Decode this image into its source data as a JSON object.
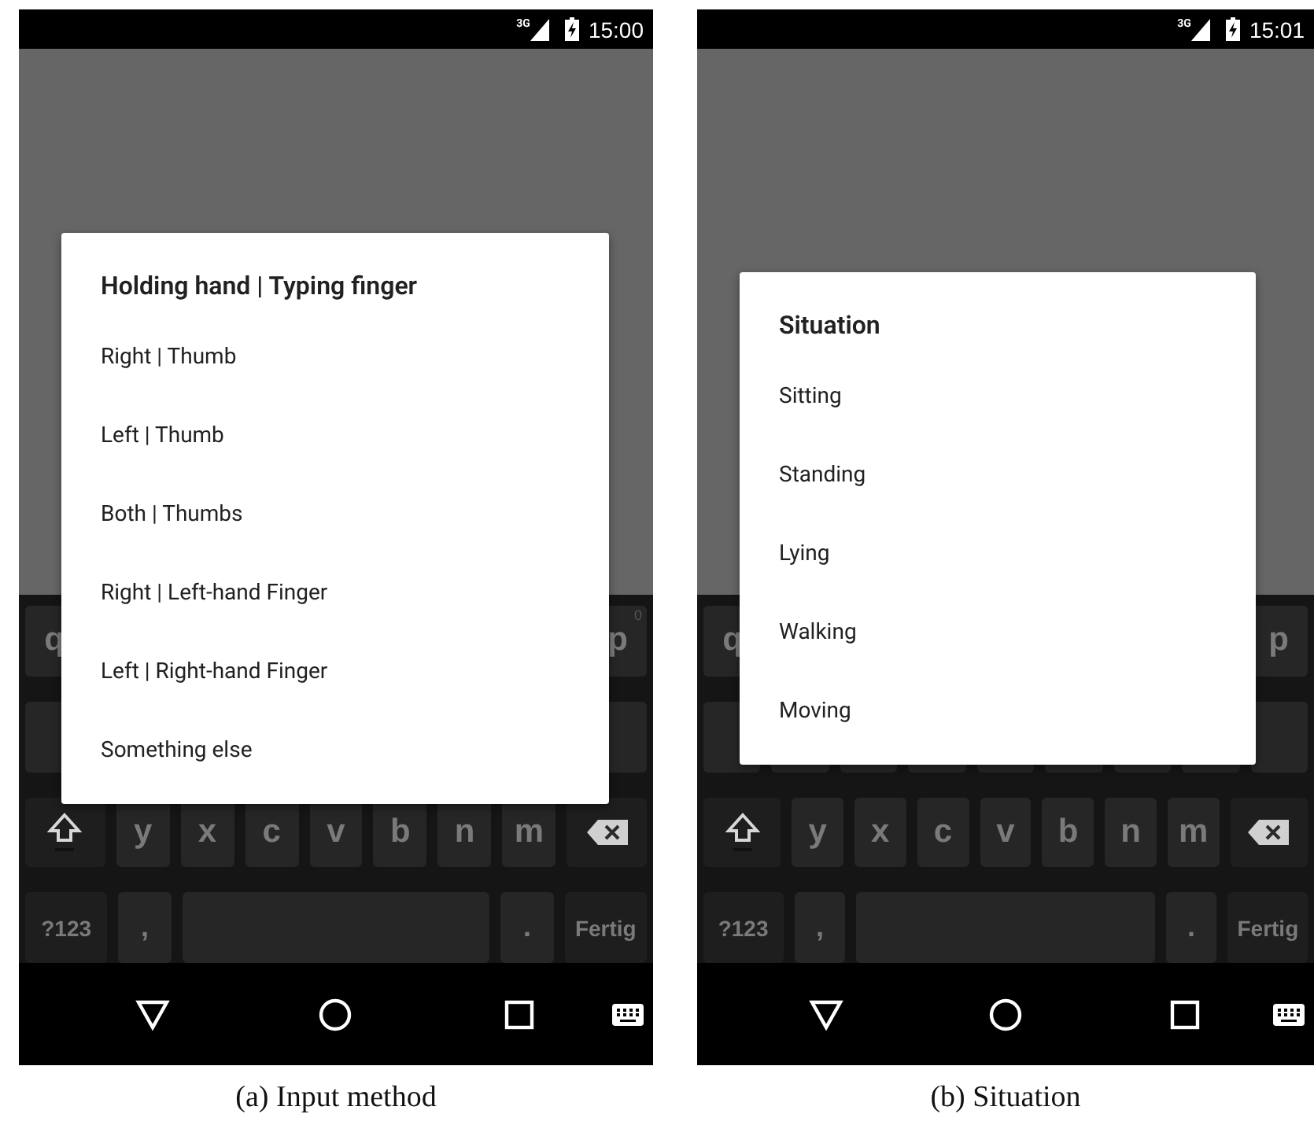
{
  "phones": [
    {
      "status_bar": {
        "network": "3G",
        "time": "15:00"
      },
      "dialog": {
        "title": "Holding hand | Typing finger",
        "options": [
          "Right | Thumb",
          "Left | Thumb",
          "Both | Thumbs",
          "Right | Left-hand Finger",
          "Left | Right-hand Finger",
          "Something else"
        ]
      },
      "keyboard": {
        "rows": [
          {
            "keys": [
              {
                "kind": "letter",
                "label": "q"
              },
              {
                "kind": "letter",
                "label": "p",
                "hint": "0"
              }
            ]
          },
          {
            "keys": [
              {
                "kind": "blank"
              },
              {
                "kind": "blank"
              }
            ]
          },
          {
            "keys": [
              {
                "kind": "shift"
              },
              {
                "kind": "letter",
                "label": "y"
              },
              {
                "kind": "letter",
                "label": "x"
              },
              {
                "kind": "letter",
                "label": "c"
              },
              {
                "kind": "letter",
                "label": "v"
              },
              {
                "kind": "letter",
                "label": "b"
              },
              {
                "kind": "letter",
                "label": "n"
              },
              {
                "kind": "letter",
                "label": "m"
              },
              {
                "kind": "backspace"
              }
            ]
          },
          {
            "keys": [
              {
                "kind": "symbols",
                "label": "?123"
              },
              {
                "kind": "punct",
                "label": ","
              },
              {
                "kind": "space"
              },
              {
                "kind": "punct",
                "label": "."
              },
              {
                "kind": "action",
                "label": "Fertig"
              }
            ]
          }
        ]
      },
      "caption": "(a) Input method"
    },
    {
      "status_bar": {
        "network": "3G",
        "time": "15:01"
      },
      "dialog": {
        "title": "Situation",
        "options": [
          "Sitting",
          "Standing",
          "Lying",
          "Walking",
          "Moving"
        ]
      },
      "keyboard": {
        "rows": [
          {
            "keys": [
              {
                "kind": "letter",
                "label": "q"
              },
              {
                "kind": "letter",
                "label": "p"
              }
            ]
          },
          {
            "keys": [
              {
                "kind": "blank"
              },
              {
                "kind": "blank"
              },
              {
                "kind": "blank"
              },
              {
                "kind": "blank"
              },
              {
                "kind": "blank"
              },
              {
                "kind": "blank"
              },
              {
                "kind": "blank"
              },
              {
                "kind": "blank"
              },
              {
                "kind": "blank"
              }
            ]
          },
          {
            "keys": [
              {
                "kind": "shift"
              },
              {
                "kind": "letter",
                "label": "y"
              },
              {
                "kind": "letter",
                "label": "x"
              },
              {
                "kind": "letter",
                "label": "c"
              },
              {
                "kind": "letter",
                "label": "v"
              },
              {
                "kind": "letter",
                "label": "b"
              },
              {
                "kind": "letter",
                "label": "n"
              },
              {
                "kind": "letter",
                "label": "m"
              },
              {
                "kind": "backspace"
              }
            ]
          },
          {
            "keys": [
              {
                "kind": "symbols",
                "label": "?123"
              },
              {
                "kind": "punct",
                "label": ","
              },
              {
                "kind": "space"
              },
              {
                "kind": "punct",
                "label": "."
              },
              {
                "kind": "action",
                "label": "Fertig"
              }
            ]
          }
        ]
      },
      "caption": "(b) Situation"
    }
  ]
}
